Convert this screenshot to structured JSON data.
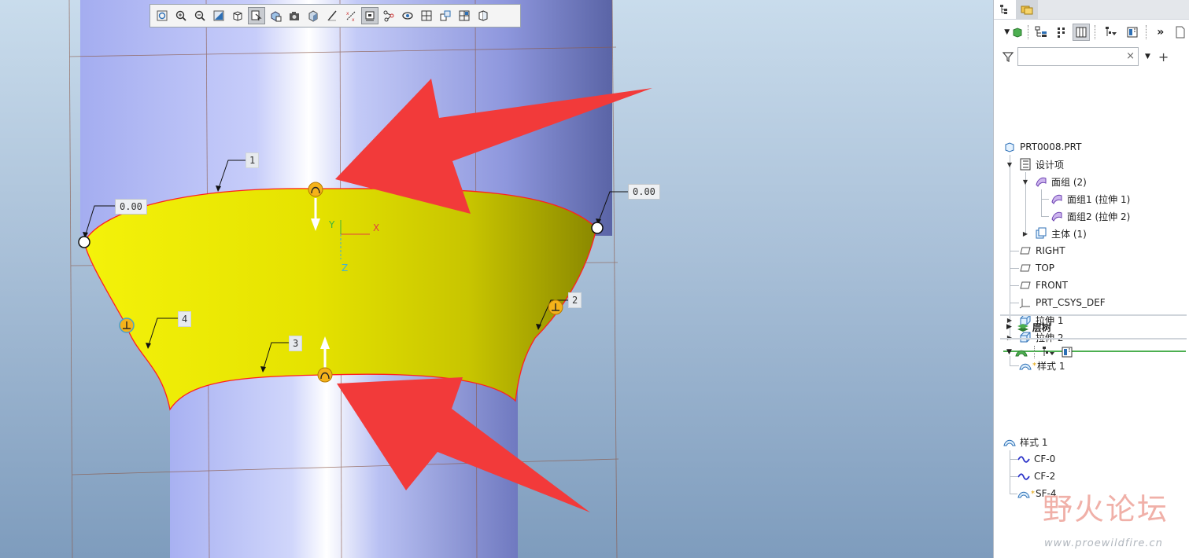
{
  "viewport": {
    "dimension_labels": {
      "left": "0.00",
      "right": "0.00"
    },
    "curve_tags": {
      "top": "1",
      "right": "2",
      "bottom": "3",
      "left": "4"
    },
    "axis_labels": {
      "x": "X",
      "y": "Y",
      "z": "Z"
    },
    "surface_color": "#f2f000",
    "cylinder_color": "#9aa6ee",
    "arrow_color": "#f23a3a",
    "toolbar": [
      {
        "name": "refit-icon",
        "active": false
      },
      {
        "name": "zoom-in-icon",
        "active": false
      },
      {
        "name": "zoom-out-icon",
        "active": false
      },
      {
        "name": "repaint-icon",
        "active": false
      },
      {
        "name": "view-manager-icon",
        "active": false
      },
      {
        "name": "saved-orientations-icon",
        "active": true
      },
      {
        "name": "display-style-icon",
        "active": false
      },
      {
        "name": "camera-icon",
        "active": false
      },
      {
        "name": "shading-icon",
        "active": false
      },
      {
        "name": "plane-display-icon",
        "active": false
      },
      {
        "name": "axis-display-icon",
        "active": false
      },
      {
        "name": "point-display-icon",
        "active": true
      },
      {
        "name": "csys-display-icon",
        "active": false
      },
      {
        "name": "spin-center-icon",
        "active": false
      },
      {
        "name": "grid-display-icon",
        "active": false
      },
      {
        "name": "active-plane-icon",
        "active": false
      },
      {
        "name": "multi-view-icon",
        "active": false
      },
      {
        "name": "annotation-icon",
        "active": false
      }
    ]
  },
  "panel": {
    "filter_placeholder": "",
    "model_tree": {
      "root": "PRT0008.PRT",
      "design_items": "设计项",
      "quilts": "面组 (2)",
      "quilt1": "面组1 (拉伸 1)",
      "quilt2": "面组2 (拉伸 2)",
      "body": "主体 (1)",
      "right": "RIGHT",
      "top": "TOP",
      "front": "FRONT",
      "csys": "PRT_CSYS_DEF",
      "extrude1": "拉伸 1",
      "extrude2": "拉伸 2",
      "style": "样式 1"
    },
    "layer_tree": {
      "label": "层树"
    },
    "style_tree": {
      "root": "样式 1",
      "cf0": "CF-0",
      "cf2": "CF-2",
      "sf4": "SF-4"
    }
  },
  "watermark": {
    "logo": "野火论坛",
    "url": "www.proewildfire.cn"
  }
}
